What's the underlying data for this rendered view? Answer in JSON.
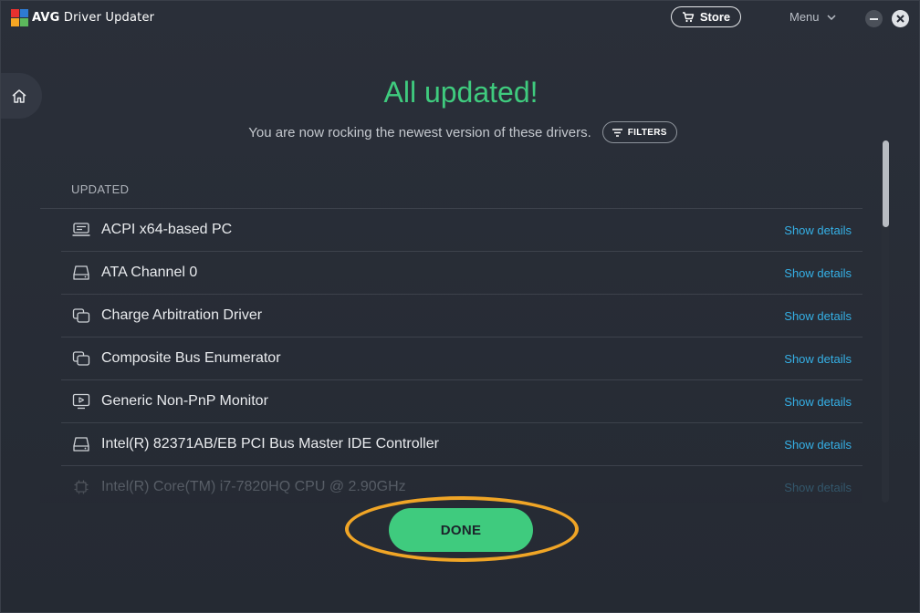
{
  "app": {
    "brand_short": "AVG",
    "brand_name": "Driver Updater",
    "logo_icon": "avg-logo-icon"
  },
  "titlebar": {
    "store_label": "Store",
    "menu_label": "Menu"
  },
  "main": {
    "heading": "All updated!",
    "subtitle": "You are now rocking the newest version of these drivers.",
    "filters_label": "FILTERS",
    "section_label": "UPDATED",
    "details_label": "Show details",
    "drivers": [
      {
        "name": "ACPI x64-based PC",
        "icon": "computer-icon"
      },
      {
        "name": "ATA Channel 0",
        "icon": "disk-drive-icon"
      },
      {
        "name": "Charge Arbitration Driver",
        "icon": "system-device-icon"
      },
      {
        "name": "Composite Bus Enumerator",
        "icon": "system-device-icon"
      },
      {
        "name": "Generic Non-PnP Monitor",
        "icon": "monitor-icon"
      },
      {
        "name": "Intel(R) 82371AB/EB PCI Bus Master IDE Controller",
        "icon": "disk-drive-icon"
      },
      {
        "name": "Intel(R) Core(TM) i7-7820HQ CPU @ 2.90GHz",
        "icon": "cpu-icon"
      }
    ],
    "done_label": "DONE"
  },
  "colors": {
    "accent_green": "#3fcb7e",
    "link_blue": "#35b0e6",
    "highlight_orange": "#f0a526",
    "background": "#262b35"
  }
}
